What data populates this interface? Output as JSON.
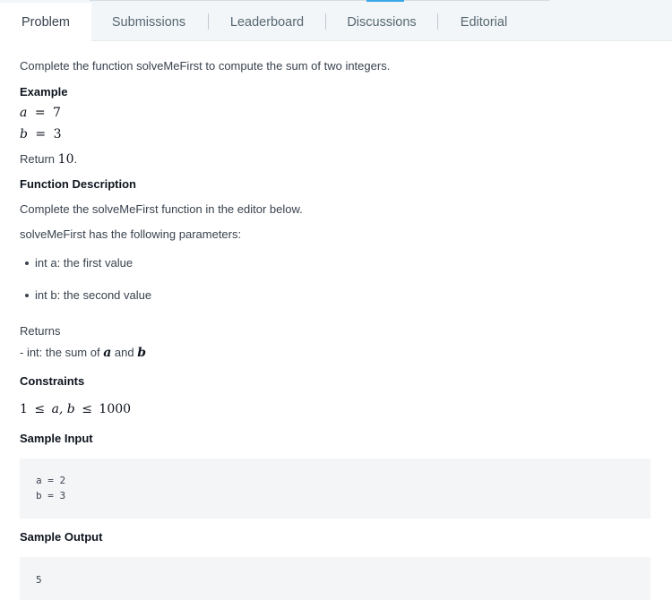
{
  "tabs": [
    {
      "label": "Problem",
      "active": true
    },
    {
      "label": "Submissions",
      "active": false
    },
    {
      "label": "Leaderboard",
      "active": false
    },
    {
      "label": "Discussions",
      "active": false
    },
    {
      "label": "Editorial",
      "active": false
    }
  ],
  "problem": {
    "intro": "Complete the function solveMeFirst to compute the sum of two integers.",
    "example_heading": "Example",
    "example_a": {
      "var": "a",
      "op": "=",
      "val": "7"
    },
    "example_b": {
      "var": "b",
      "op": "=",
      "val": "3"
    },
    "return_prefix": "Return",
    "return_value": "10",
    "return_suffix": ".",
    "function_description_heading": "Function Description",
    "function_description_text": "Complete the solveMeFirst function in the editor below.",
    "params_intro": "solveMeFirst has the following parameters:",
    "params": [
      "int a: the first value",
      "int b: the second value"
    ],
    "returns_label": "Returns",
    "returns_prefix": "- int: the sum of",
    "returns_var_a": "a",
    "returns_and": "and",
    "returns_var_b": "b",
    "constraints_heading": "Constraints",
    "constraint": {
      "low": "1",
      "le1": "≤",
      "vars": "a, b",
      "le2": "≤",
      "high": "1000"
    },
    "sample_input_heading": "Sample Input",
    "sample_input_lines": [
      "a = 2",
      "b = 3"
    ],
    "sample_output_heading": "Sample Output",
    "sample_output_lines": [
      "5"
    ]
  },
  "colors": {
    "tabbar_bg": "#f3f6f9",
    "text": "#39424e",
    "heading": "#0e141e",
    "code_bg": "#f3f5f7",
    "accent": "#39a8e6"
  }
}
